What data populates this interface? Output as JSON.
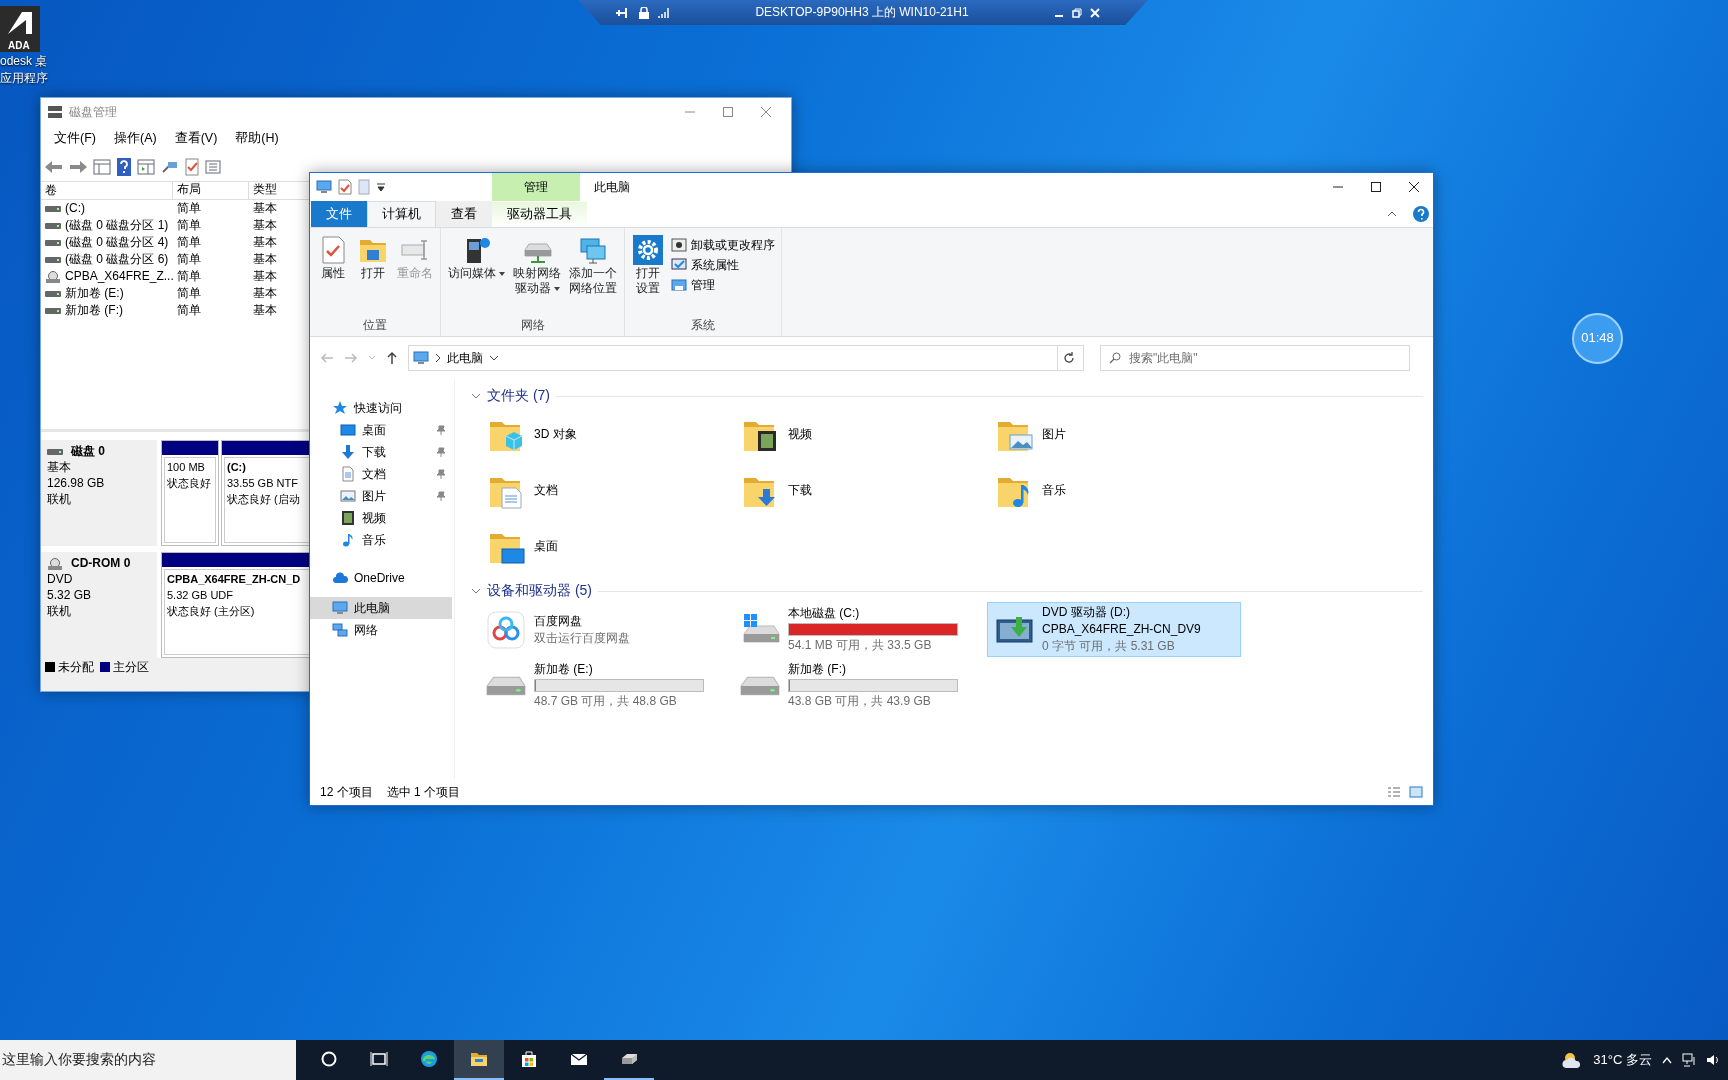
{
  "remote_bar": {
    "title": "DESKTOP-9P90HH3 上的 WIN10-21H1"
  },
  "desktop_icon": {
    "badge": "ADA",
    "label_lines": [
      "odesk 桌",
      "应用程序"
    ]
  },
  "timer": "01:48",
  "disk_management": {
    "title": "磁盘管理",
    "menu": [
      "文件(F)",
      "操作(A)",
      "查看(V)",
      "帮助(H)"
    ],
    "columns": [
      "卷",
      "布局",
      "类型"
    ],
    "rows": [
      {
        "kind": "drive",
        "cells": [
          "(C:)",
          "简单",
          "基本"
        ]
      },
      {
        "kind": "drive",
        "cells": [
          "(磁盘 0 磁盘分区 1)",
          "简单",
          "基本"
        ]
      },
      {
        "kind": "drive",
        "cells": [
          "(磁盘 0 磁盘分区 4)",
          "简单",
          "基本"
        ]
      },
      {
        "kind": "drive",
        "cells": [
          "(磁盘 0 磁盘分区 6)",
          "简单",
          "基本"
        ]
      },
      {
        "kind": "cd",
        "cells": [
          "CPBA_X64FRE_Z...",
          "简单",
          "基本"
        ]
      },
      {
        "kind": "drive",
        "cells": [
          "新加卷 (E:)",
          "简单",
          "基本"
        ]
      },
      {
        "kind": "drive",
        "cells": [
          "新加卷 (F:)",
          "简单",
          "基本"
        ]
      }
    ],
    "disks": [
      {
        "kind": "drive",
        "name": "磁盘 0",
        "lines": [
          "基本",
          "126.98 GB",
          "联机"
        ],
        "partitions": [
          {
            "lines": [
              "100 MB",
              "状态良好"
            ]
          },
          {
            "title": "(C:)",
            "lines": [
              "33.55 GB NTF",
              "状态良好 (启动"
            ]
          }
        ]
      },
      {
        "kind": "cd",
        "name": "CD-ROM 0",
        "lines": [
          "DVD",
          "5.32 GB",
          "联机"
        ],
        "partitions": [
          {
            "title": "CPBA_X64FRE_ZH-CN_D",
            "lines": [
              "5.32 GB UDF",
              "状态良好 (主分区)"
            ]
          }
        ]
      }
    ],
    "legend": [
      {
        "label": "未分配",
        "color": "#000000"
      },
      {
        "label": "主分区",
        "color": "#000080"
      }
    ]
  },
  "explorer": {
    "title": "此电脑",
    "context_header": "管理",
    "tabs": [
      {
        "kind": "file",
        "label": "文件",
        "selected": false
      },
      {
        "kind": "tab",
        "label": "计算机",
        "selected": true
      },
      {
        "kind": "tab",
        "label": "查看",
        "selected": false
      },
      {
        "kind": "context",
        "label": "驱动器工具",
        "selected": false
      }
    ],
    "ribbon_groups": [
      {
        "label": "位置",
        "buttons": [
          {
            "kind": "properties",
            "lines": [
              "属性"
            ],
            "dropdown": false,
            "disabled": false
          },
          {
            "kind": "open",
            "lines": [
              "打开"
            ],
            "dropdown": false,
            "disabled": false
          },
          {
            "kind": "rename",
            "lines": [
              "重命名"
            ],
            "dropdown": false,
            "disabled": true
          }
        ]
      },
      {
        "label": "网络",
        "buttons": [
          {
            "kind": "media",
            "lines": [
              "访问媒体"
            ],
            "dropdown": true,
            "disabled": false
          },
          {
            "kind": "map-drive",
            "lines": [
              "映射网络",
              "驱动器"
            ],
            "dropdown": true,
            "disabled": false
          },
          {
            "kind": "add-location",
            "lines": [
              "添加一个",
              "网络位置"
            ],
            "dropdown": false,
            "disabled": false
          }
        ]
      },
      {
        "label": "系统",
        "buttons": [
          {
            "kind": "settings",
            "lines": [
              "打开",
              "设置"
            ],
            "dropdown": false,
            "disabled": false
          }
        ],
        "small_buttons": [
          {
            "kind": "uninstall",
            "label": "卸载或更改程序"
          },
          {
            "kind": "system",
            "label": "系统属性"
          },
          {
            "kind": "manage",
            "label": "管理"
          }
        ]
      }
    ],
    "address": "此电脑",
    "search_placeholder": "搜索\"此电脑\"",
    "nav": [
      {
        "kind": "star",
        "label": "快速访问",
        "selected": false,
        "children": [
          {
            "kind": "desktop",
            "label": "桌面",
            "pinned": true,
            "selected": false
          },
          {
            "kind": "download",
            "label": "下载",
            "pinned": true,
            "selected": false
          },
          {
            "kind": "doc",
            "label": "文档",
            "pinned": true,
            "selected": false
          },
          {
            "kind": "picture",
            "label": "图片",
            "pinned": true,
            "selected": false
          },
          {
            "kind": "video",
            "label": "视频",
            "pinned": false,
            "selected": false
          },
          {
            "kind": "music",
            "label": "音乐",
            "pinned": false,
            "selected": false
          }
        ]
      },
      {
        "kind": "cloud",
        "label": "OneDrive",
        "selected": false
      },
      {
        "kind": "pc",
        "label": "此电脑",
        "selected": true
      },
      {
        "kind": "network",
        "label": "网络",
        "selected": false
      }
    ],
    "sections": [
      {
        "label": "文件夹 (7)",
        "expanded": true,
        "items": [
          {
            "kind": "cube",
            "label": "3D 对象",
            "selected": false
          },
          {
            "kind": "video",
            "label": "视频",
            "selected": false
          },
          {
            "kind": "pictures",
            "label": "图片",
            "selected": false
          },
          {
            "kind": "documents",
            "label": "文档",
            "selected": false
          },
          {
            "kind": "downloads",
            "label": "下载",
            "selected": false
          },
          {
            "kind": "music",
            "label": "音乐",
            "selected": false
          },
          {
            "kind": "desktop",
            "label": "桌面",
            "selected": false
          }
        ]
      },
      {
        "label": "设备和驱动器 (5)",
        "expanded": true,
        "items": [
          {
            "kind": "app",
            "label": "百度网盘",
            "detail": "双击运行百度网盘",
            "selected": false
          },
          {
            "kind": "system-drive",
            "label": "本地磁盘 (C:)",
            "level": 0.998,
            "detail": "54.1 MB 可用，共 33.5 GB",
            "selected": false
          },
          {
            "kind": "dvd",
            "label": "DVD 驱动器 (D:)",
            "subtitle": "CPBA_X64FRE_ZH-CN_DV9",
            "detail": "0 字节 可用，共 5.31 GB",
            "selected": true
          },
          {
            "kind": "drive",
            "label": "新加卷 (E:)",
            "level": 0.002,
            "detail": "48.7 GB 可用，共 48.8 GB",
            "selected": false
          },
          {
            "kind": "drive",
            "label": "新加卷 (F:)",
            "level": 0.003,
            "detail": "43.8 GB 可用，共 43.9 GB",
            "selected": false
          }
        ]
      }
    ],
    "status": [
      "12 个项目",
      "选中 1 个项目"
    ]
  },
  "taskbar": {
    "search_placeholder": "这里输入你要搜索的内容",
    "apps": [
      {
        "kind": "cortana",
        "active": false,
        "running": false
      },
      {
        "kind": "task-view",
        "active": false,
        "running": false
      },
      {
        "kind": "edge",
        "active": false,
        "running": false
      },
      {
        "kind": "explorer",
        "active": true,
        "running": true
      },
      {
        "kind": "store",
        "active": false,
        "running": false
      },
      {
        "kind": "mail",
        "active": false,
        "running": false
      },
      {
        "kind": "disk-app",
        "active": false,
        "running": true
      }
    ],
    "weather": "31°C 多云"
  }
}
